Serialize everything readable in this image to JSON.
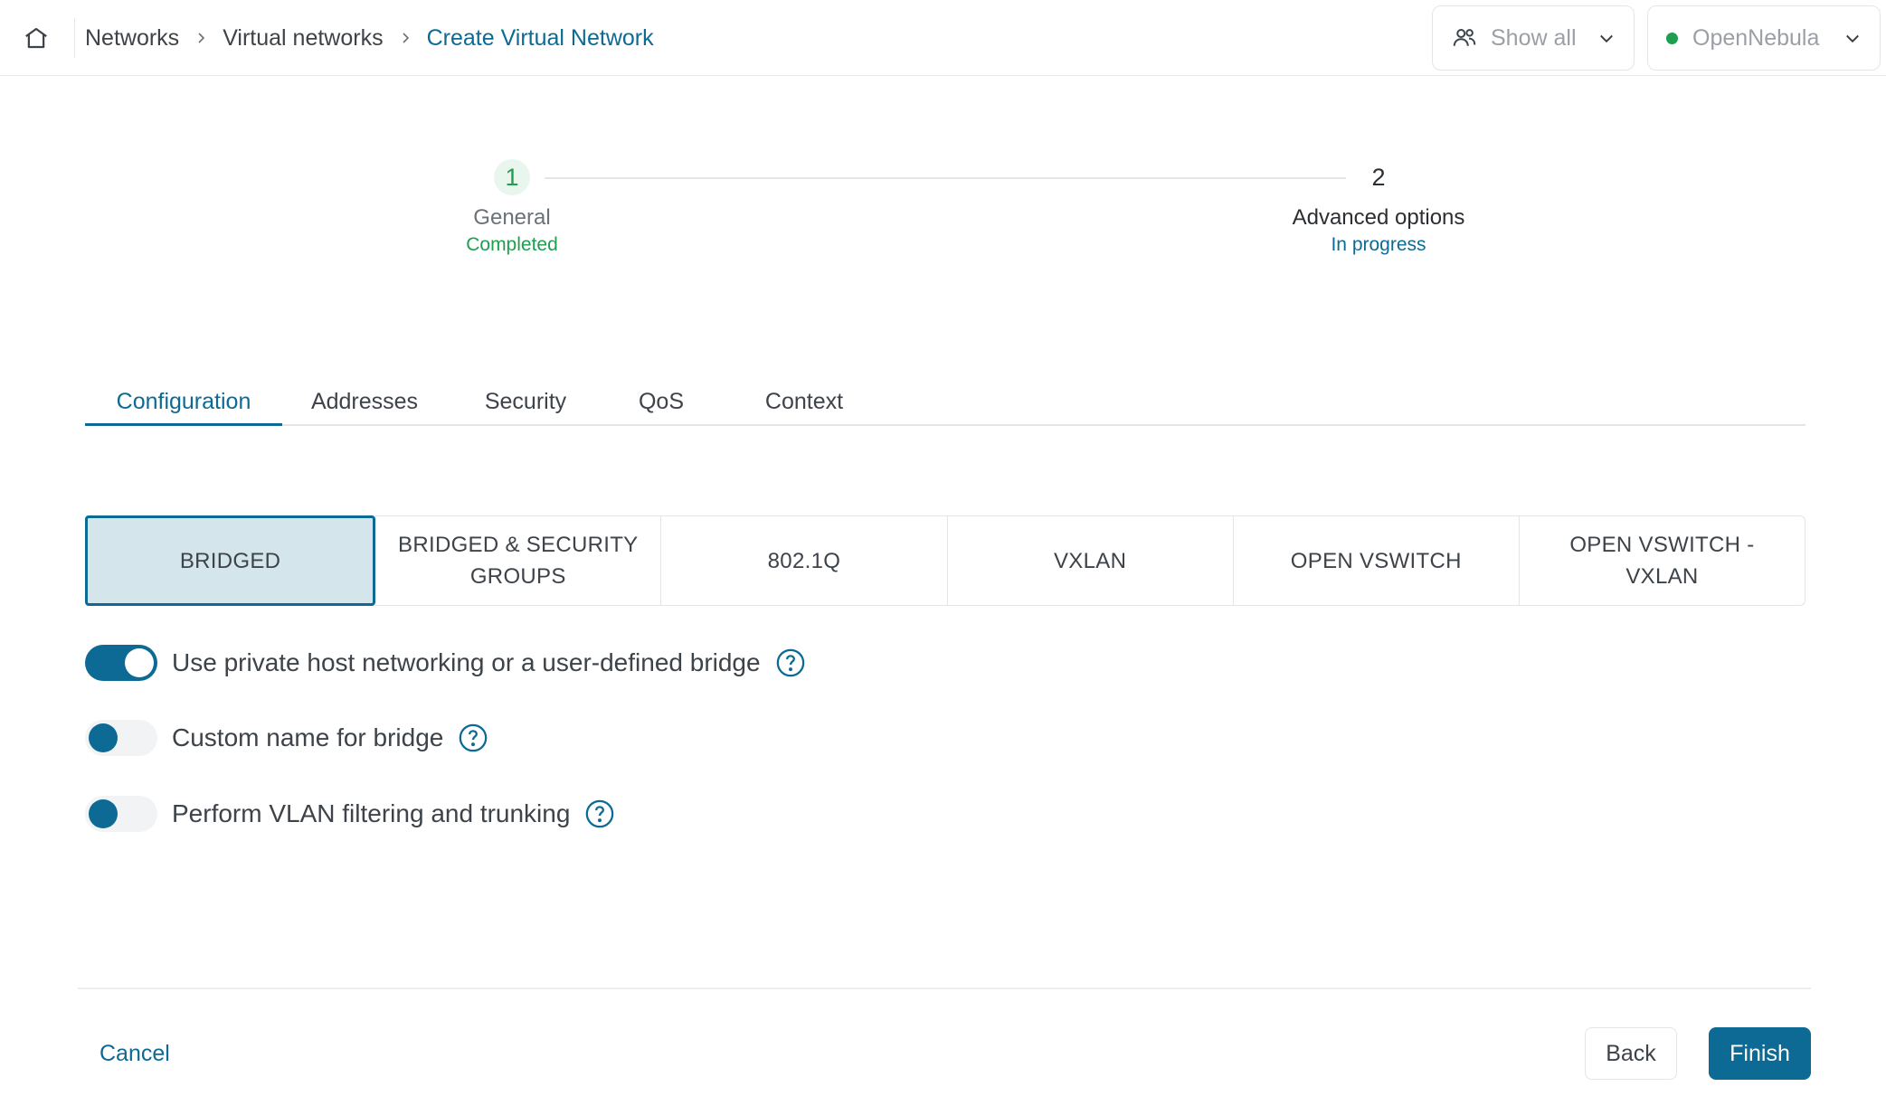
{
  "header": {
    "breadcrumb": [
      "Networks",
      "Virtual networks",
      "Create Virtual Network"
    ],
    "group_select": "Show all",
    "cloud_select": "OpenNebula",
    "cloud_status_color": "#1e9e4f"
  },
  "stepper": {
    "steps": [
      {
        "number": "1",
        "title": "General",
        "status": "Completed"
      },
      {
        "number": "2",
        "title": "Advanced options",
        "status": "In progress"
      }
    ]
  },
  "tabs": [
    "Configuration",
    "Addresses",
    "Security",
    "QoS",
    "Context"
  ],
  "active_tab": "Configuration",
  "drivers": {
    "options": [
      "BRIDGED",
      "BRIDGED & SECURITY GROUPS",
      "802.1Q",
      "VXLAN",
      "OPEN VSWITCH",
      "OPEN VSWITCH - VXLAN"
    ],
    "selected": "BRIDGED"
  },
  "switches": [
    {
      "label": "Use private host networking or a user-defined bridge",
      "on": true
    },
    {
      "label": "Custom name for bridge",
      "on": false
    },
    {
      "label": "Perform VLAN filtering and trunking",
      "on": false
    }
  ],
  "footer": {
    "cancel": "Cancel",
    "back": "Back",
    "finish": "Finish"
  },
  "colors": {
    "accent": "#0c6a95",
    "success": "#1e9e4f",
    "selected_bg": "#d4e5ec"
  }
}
